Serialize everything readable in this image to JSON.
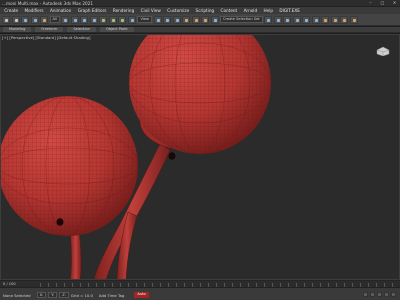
{
  "window": {
    "title": "...moni Multi.max - Autodesk 3ds Max 2021",
    "controls": [
      "–",
      "□",
      "✕"
    ]
  },
  "menubar": {
    "items": [
      "Create",
      "Modifiers",
      "Animation",
      "Graph Editors",
      "Rendering",
      "Civil View",
      "Customize",
      "Scripting",
      "Content",
      "Arnold",
      "Help",
      "DIGIT.EXE"
    ]
  },
  "toolbar": {
    "selection_dropdown": "All",
    "view_dropdown": "View",
    "create_selection_set": "Create Selection Set"
  },
  "ribbon": {
    "tabs": [
      "Modeling",
      "Freeform",
      "Selection",
      "Object Paint"
    ]
  },
  "viewport": {
    "label": "[+] [Perspective] [Standard] [Default Shading]",
    "background": "#2b2b2b",
    "model_color": "#b73a36",
    "wire_color": "#7a1e1c"
  },
  "status_bar": {
    "frame": "0 / 100",
    "selection_text": "None Selected",
    "x": "X:",
    "y": "Y:",
    "z": "Z:",
    "grid": "Grid = 10.0",
    "add_time_tag": "Add Time Tag",
    "auto_key": "Auto"
  }
}
